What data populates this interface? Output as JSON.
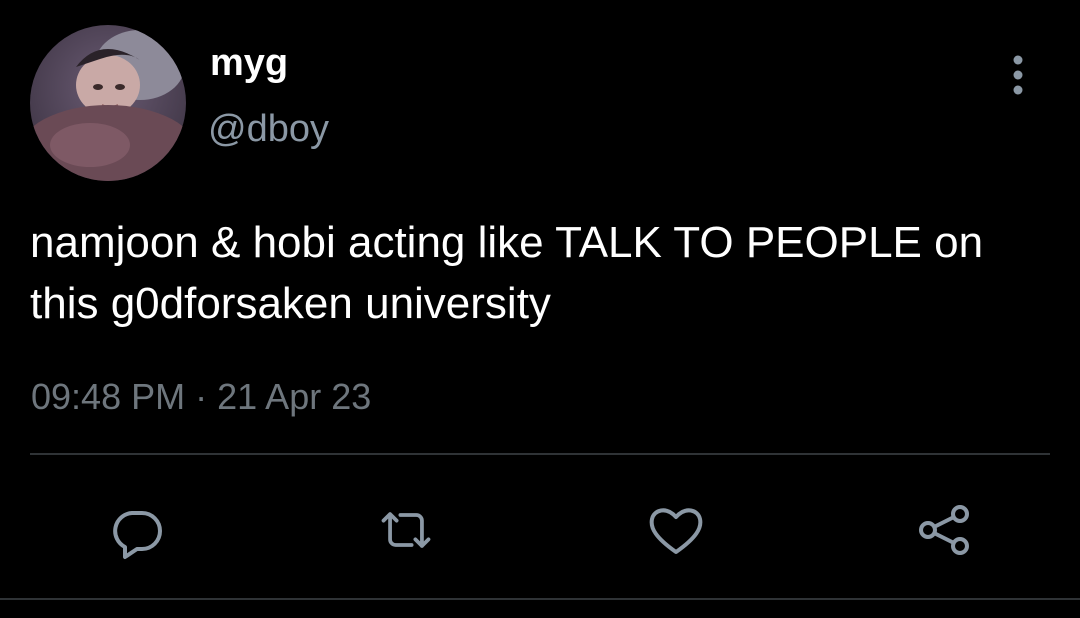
{
  "tweet": {
    "display_name": "myg",
    "handle": "@dboy",
    "text": "namjoon & hobi acting like TALK TO PEOPLE on this g0dforsaken university",
    "time": "09:48 PM",
    "separator": "·",
    "date": "21 Apr 23"
  },
  "icons": {
    "more": "more-vertical-icon",
    "reply": "reply-icon",
    "retweet": "retweet-icon",
    "like": "heart-icon",
    "share": "share-icon"
  },
  "colors": {
    "background": "#000000",
    "text": "#ffffff",
    "secondary": "#8b98a5",
    "icon": "#8b98a5",
    "divider": "#2f3336"
  }
}
